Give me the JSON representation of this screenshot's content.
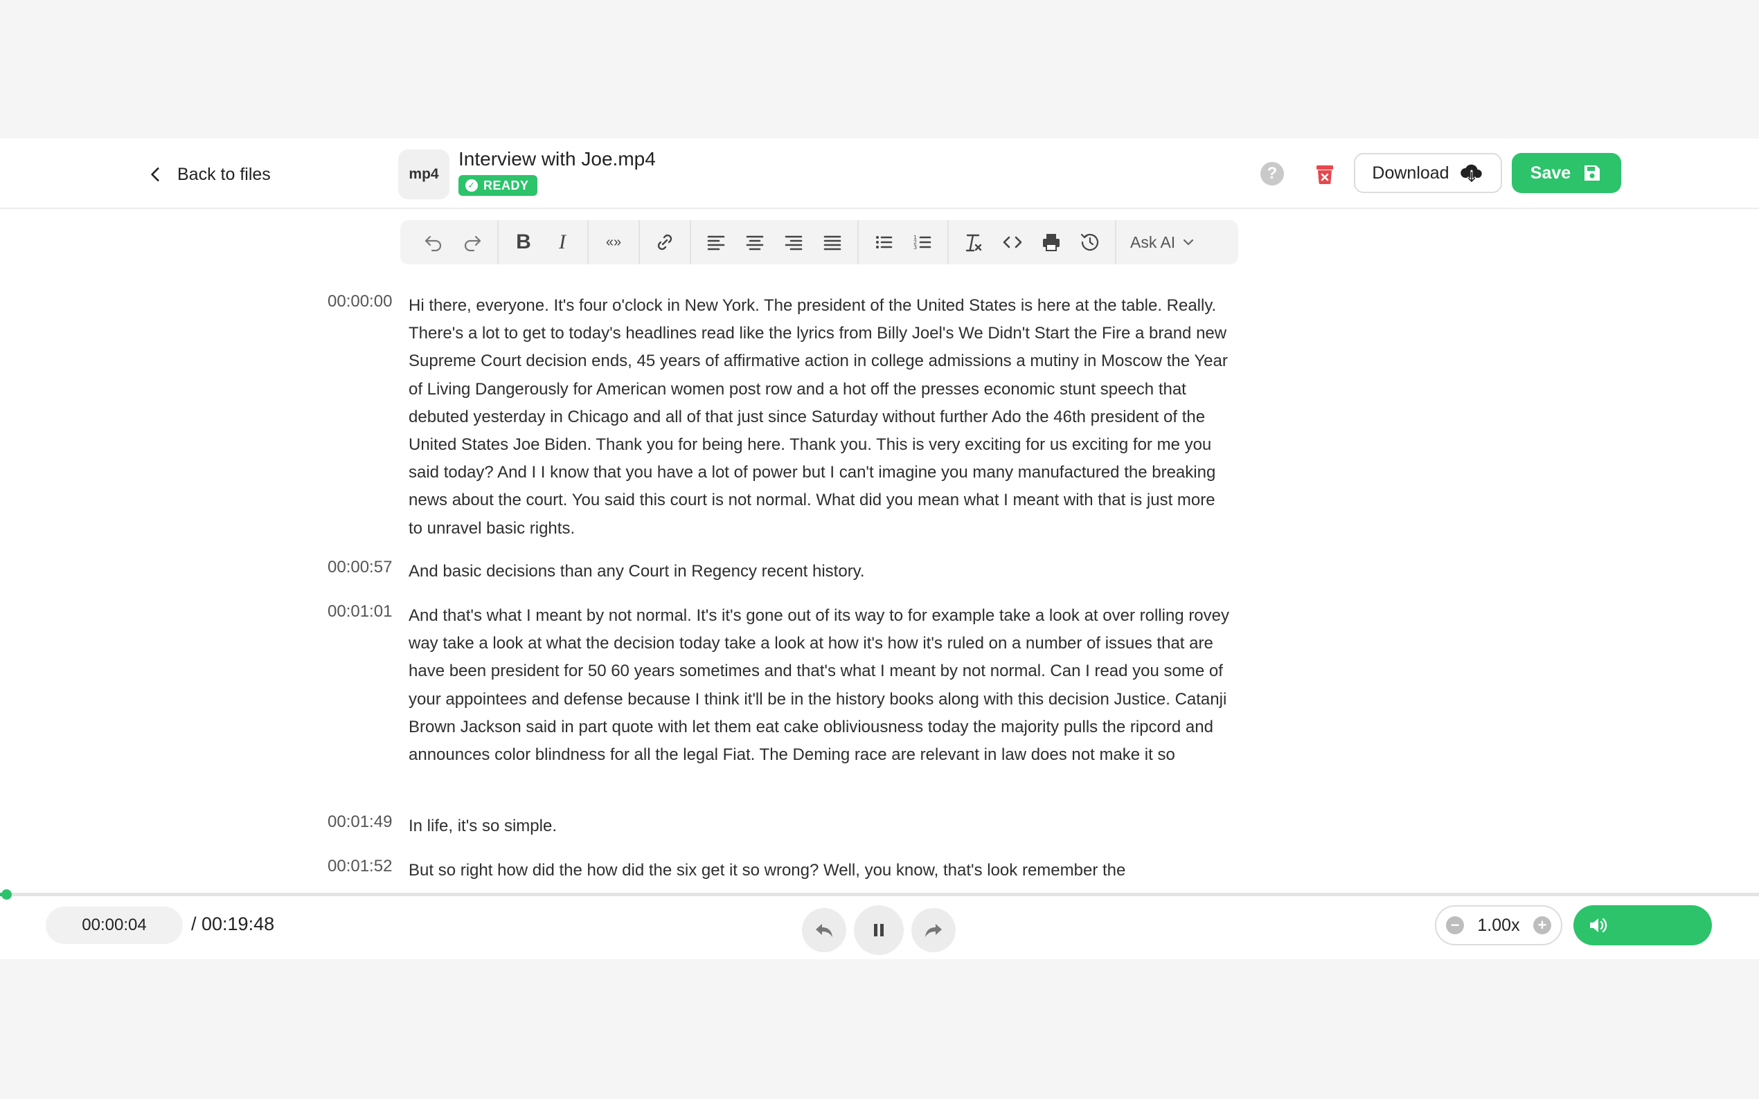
{
  "header": {
    "back_label": "Back to files",
    "file_type": "mp4",
    "file_name": "Interview with Joe.mp4",
    "status": "READY",
    "help_symbol": "?",
    "download_label": "Download",
    "save_label": "Save"
  },
  "toolbar": {
    "items": [
      "undo-icon",
      "redo-icon",
      "bold-icon",
      "italic-icon",
      "quote-icon",
      "link-icon",
      "align-left-icon",
      "align-center-icon",
      "align-right-icon",
      "align-justify-icon",
      "bullet-list-icon",
      "numbered-list-icon",
      "clear-format-icon",
      "code-icon",
      "print-icon",
      "history-icon"
    ],
    "bold_glyph": "B",
    "italic_glyph": "I",
    "quote_glyph": "«»",
    "ask_ai_label": "Ask AI"
  },
  "transcript": [
    {
      "time": "00:00:00",
      "text": "Hi there, everyone. It's four o'clock in New York. The president of the United States is here at the table. Really. There's a lot to get to today's headlines read like the lyrics from Billy Joel's We Didn't Start the Fire a brand new Supreme Court decision ends, 45 years of affirmative action in college admissions a mutiny in Moscow the Year of Living Dangerously for American women post row and a hot off the presses economic stunt speech that debuted yesterday in Chicago and all of that just since Saturday without further Ado the 46th president of the United States Joe Biden. Thank you for being here. Thank you. This is very exciting for us exciting for me you said today? And I I know that you have a lot of power but I can't imagine you many manufactured the breaking news about the court. You said this court is not normal. What did you mean what I meant with that is just more to unravel basic rights."
    },
    {
      "time": "00:00:57",
      "text": "And basic decisions than any Court in Regency recent history."
    },
    {
      "time": "00:01:01",
      "text": "And that's what I meant by not normal. It's it's gone out of its way to for example take a look at over rolling rovey way take a look at what the decision today take a look at how it's how it's ruled on a number of issues that are have been president for 50 60 years sometimes and that's what I meant by not normal. Can I read you some of your appointees and defense because I think it'll be in the history books along with this decision Justice. Catanji Brown Jackson said in part quote with let them eat cake obliviousness today the majority pulls the ripcord and announces color blindness for all the legal Fiat. The Deming race are relevant in law does not make it so"
    },
    {
      "time": "00:01:49",
      "text": "In life, it's so simple."
    },
    {
      "time": "00:01:52",
      "text": "But so right how did the how did the six get it so wrong? Well, you know, that's look remember the"
    }
  ],
  "player": {
    "current_time": "00:00:04",
    "total_time": "/ 00:19:48",
    "progress_fraction": 0.0034,
    "speed": "1.00x",
    "speed_minus": "−",
    "speed_plus": "+",
    "accent_color": "#2cc36b",
    "danger_color": "#e5484d"
  }
}
